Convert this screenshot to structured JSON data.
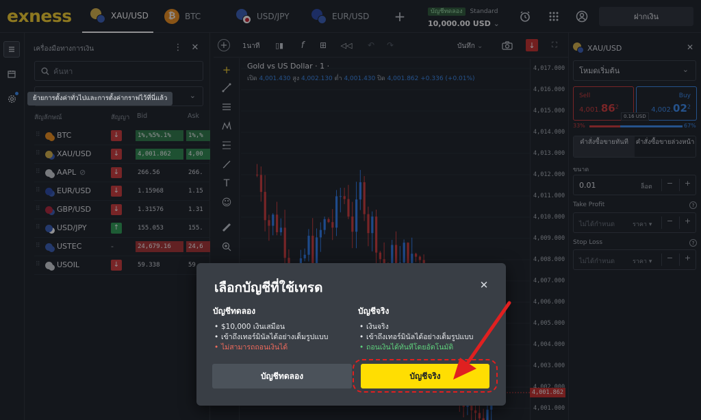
{
  "brand": {
    "logo": "exness",
    "accent": "#f8d12f"
  },
  "tabs": [
    {
      "label": "XAU/USD",
      "active": true
    },
    {
      "label": "BTC"
    },
    {
      "label": "USD/JPY"
    },
    {
      "label": "EUR/USD"
    }
  ],
  "account": {
    "type_badge": "บัญชีทดลอง",
    "plan": "Standard",
    "balance": "10,000.00 USD"
  },
  "header": {
    "deposit_label": "ฝากเงิน"
  },
  "instruments": {
    "title": "เครื่องมือทางการเงิน",
    "search_placeholder": "ค้นหา",
    "tooltip": "ย้ายการตั้งค่าทั่วไปและการตั้งค่ากราฟไว้ที่นี่แล้ว",
    "columns": {
      "symbol": "สัญลักษณ์",
      "signal": "สัญญา",
      "bid": "Bid",
      "ask": "Ask"
    },
    "rows": [
      {
        "symbol": "BTC",
        "signal": "down",
        "bid": "1%,%5%.1%",
        "ask": "1%,%",
        "bid_bg": "#2f7d4a",
        "ask_bg": "#2f7d4a"
      },
      {
        "symbol": "XAU/USD",
        "signal": "down",
        "bid": "4,001.862",
        "ask": "4,00",
        "bid_bg": "#2f8a4f",
        "ask_bg": "#2f8a4f"
      },
      {
        "symbol": "AAPL",
        "signal": "down",
        "bid": "266.56",
        "ask": "266.",
        "bid_bg": "",
        "ask_bg": ""
      },
      {
        "symbol": "EUR/USD",
        "signal": "down",
        "bid": "1.15968",
        "ask": "1.15",
        "bid_bg": "",
        "ask_bg": ""
      },
      {
        "symbol": "GBP/USD",
        "signal": "down",
        "bid": "1.31576",
        "ask": "1.31",
        "bid_bg": "",
        "ask_bg": ""
      },
      {
        "symbol": "USD/JPY",
        "signal": "up",
        "bid": "155.053",
        "ask": "155.",
        "bid_bg": "",
        "ask_bg": ""
      },
      {
        "symbol": "USTEC",
        "signal": "none",
        "signal_text": "-",
        "bid": "24,679.16",
        "ask": "24,6",
        "bid_bg": "#a93434",
        "ask_bg": "#a93434"
      },
      {
        "symbol": "USOIL",
        "signal": "down",
        "bid": "59.338",
        "ask": "59.",
        "bid_bg": "",
        "ask_bg": ""
      }
    ]
  },
  "chart": {
    "timeframe": "1นาที",
    "save_label": "บันทึก",
    "title": "Gold vs US Dollar · 1 ·",
    "ohlc": {
      "open_label": "เปิด",
      "open": "4,001.430",
      "high_label": "สูง",
      "high": "4,002.130",
      "low_label": "ต่ำ",
      "low": "4,001.430",
      "close_label": "ปิด",
      "close": "4,001.862",
      "change": "+0.336 (+0.01%)"
    },
    "price_ticks": [
      "4,017.000",
      "4,016.000",
      "4,015.000",
      "4,014.000",
      "4,013.000",
      "4,012.000",
      "4,011.000",
      "4,010.000",
      "4,009.000",
      "4,008.000",
      "4,007.000",
      "4,006.000",
      "4,005.000",
      "4,004.000",
      "4,003.000",
      "4,002.000",
      "4,001.000"
    ],
    "current_price": "4,001.862"
  },
  "order": {
    "symbol": "XAU/USD",
    "mode": "โหมดเริ่มต้น",
    "sell_label": "Sell",
    "sell_price_main": "4,001.",
    "sell_price_big": "86",
    "sell_price_sup": "2",
    "buy_label": "Buy",
    "buy_price_main": "4,002.",
    "buy_price_big": "02",
    "buy_price_sup": "2",
    "spread": "0.16 USD",
    "sell_pct": "33%",
    "buy_pct": "67%",
    "market_tab": "คำสั่งซื้อขายทันที",
    "pending_tab": "คำสั่งซื้อขายล่วงหน้า",
    "size_label": "ขนาด",
    "size_value": "0.01",
    "size_unit": "ล็อต",
    "tp_label": "Take Profit",
    "tp_placeholder": "ไม่ได้กำหนด",
    "tp_unit": "ราคา",
    "sl_label": "Stop Loss",
    "sl_placeholder": "ไม่ได้กำหนด",
    "sl_unit": "ราคา"
  },
  "modal": {
    "title": "เลือกบัญชีที่ใช้เทรด",
    "demo": {
      "heading": "บัญชีทดลอง",
      "points": [
        "$10,000 เงินเสมือน",
        "เข้าถึงเทอร์มินัลได้อย่างเต็มรูปแบบ"
      ],
      "warn": "ไม่สามารถถอนเงินได้",
      "button": "บัญชีทดลอง"
    },
    "real": {
      "heading": "บัญชีจริง",
      "points": [
        "เงินจริง",
        "เข้าถึงเทอร์มินัลได้อย่างเต็มรูปแบบ"
      ],
      "good": "ถอนเงินได้ทันทีโดยอัตโนมัติ",
      "button": "บัญชีจริง"
    }
  },
  "colors": {
    "down": "#d23b3b",
    "up": "#2e9e55",
    "real_button": "#ffde02",
    "highlight": "#e02020"
  }
}
